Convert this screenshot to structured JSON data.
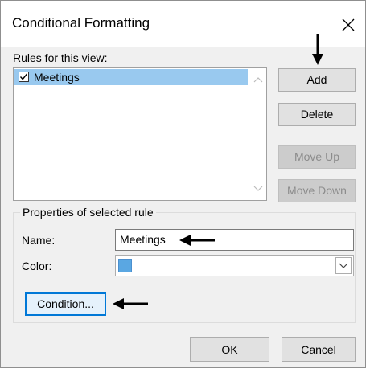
{
  "dialog": {
    "title": "Conditional Formatting"
  },
  "rules": {
    "label": "Rules for this view:",
    "items": [
      {
        "label": "Meetings",
        "checked": true,
        "selected": true
      }
    ]
  },
  "buttons": {
    "add": "Add",
    "delete": "Delete",
    "move_up": "Move Up",
    "move_down": "Move Down",
    "condition": "Condition...",
    "ok": "OK",
    "cancel": "Cancel"
  },
  "properties": {
    "group_title": "Properties of selected rule",
    "name_label": "Name:",
    "name_value": "Meetings",
    "color_label": "Color:",
    "color_value": "#5aa7e2"
  },
  "icons": {
    "close": "close-icon",
    "checkbox": "checkmark-icon",
    "scroll_up": "chevron-up-icon",
    "scroll_down": "chevron-down-icon",
    "combo_dropdown": "chevron-down-icon",
    "annotation_arrows": "arrow-icon"
  },
  "colors": {
    "selection": "#99c9ef",
    "focus_border": "#0078d7",
    "dialog_bg": "#f0f0f0"
  }
}
